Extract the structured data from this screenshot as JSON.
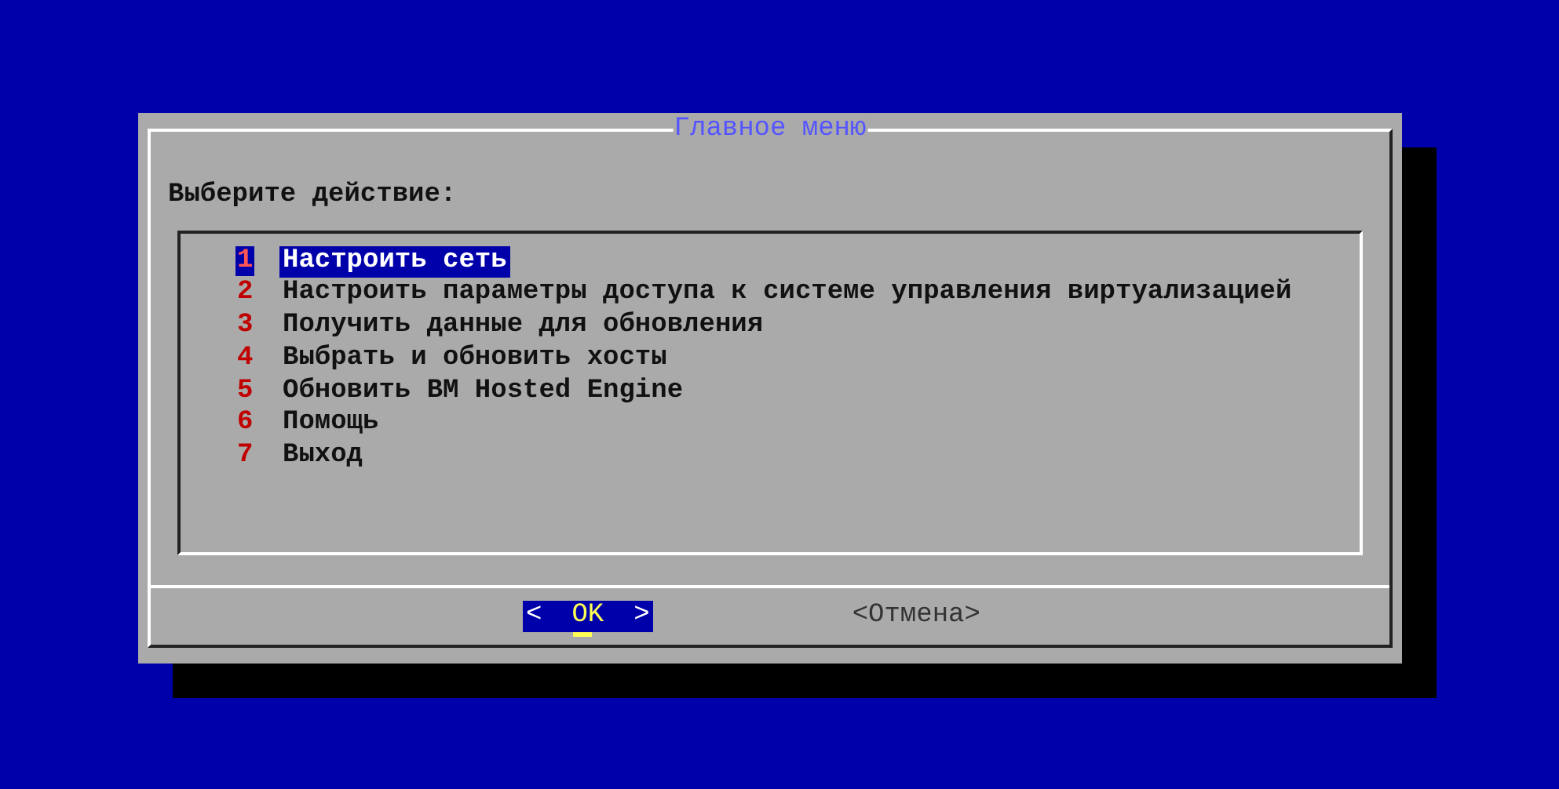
{
  "dialog": {
    "title": "Главное меню",
    "prompt": "Выберите действие:",
    "items": [
      {
        "number": "1",
        "label": "Настроить сеть",
        "selected": true
      },
      {
        "number": "2",
        "label": "Настроить параметры доступа к системе управления виртуализацией",
        "selected": false
      },
      {
        "number": "3",
        "label": "Получить данные для обновления",
        "selected": false
      },
      {
        "number": "4",
        "label": "Выбрать и обновить хосты",
        "selected": false
      },
      {
        "number": "5",
        "label": "Обновить ВМ Hosted Engine",
        "selected": false
      },
      {
        "number": "6",
        "label": "Помощь",
        "selected": false
      },
      {
        "number": "7",
        "label": "Выход",
        "selected": false
      }
    ],
    "buttons": [
      {
        "left": "<",
        "label": "OK",
        "right": ">",
        "selected": true
      },
      {
        "left": "<",
        "label": "Отмена",
        "right": ">",
        "selected": false
      }
    ]
  }
}
